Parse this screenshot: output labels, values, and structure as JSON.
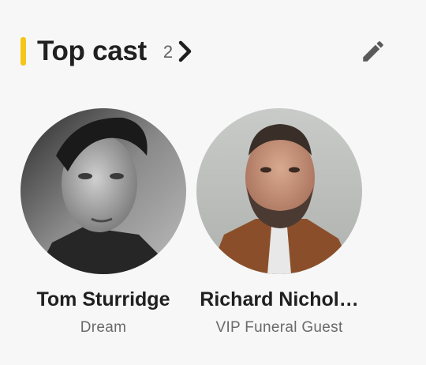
{
  "section": {
    "title": "Top cast",
    "count": "2",
    "accent_color": "#f5c518"
  },
  "cast": [
    {
      "name": "Tom Sturridge",
      "role": "Dream"
    },
    {
      "name": "Richard Nichol…",
      "role": "VIP Funeral Guest"
    }
  ],
  "icons": {
    "more": "chevron-right-icon",
    "edit": "pencil-icon"
  }
}
